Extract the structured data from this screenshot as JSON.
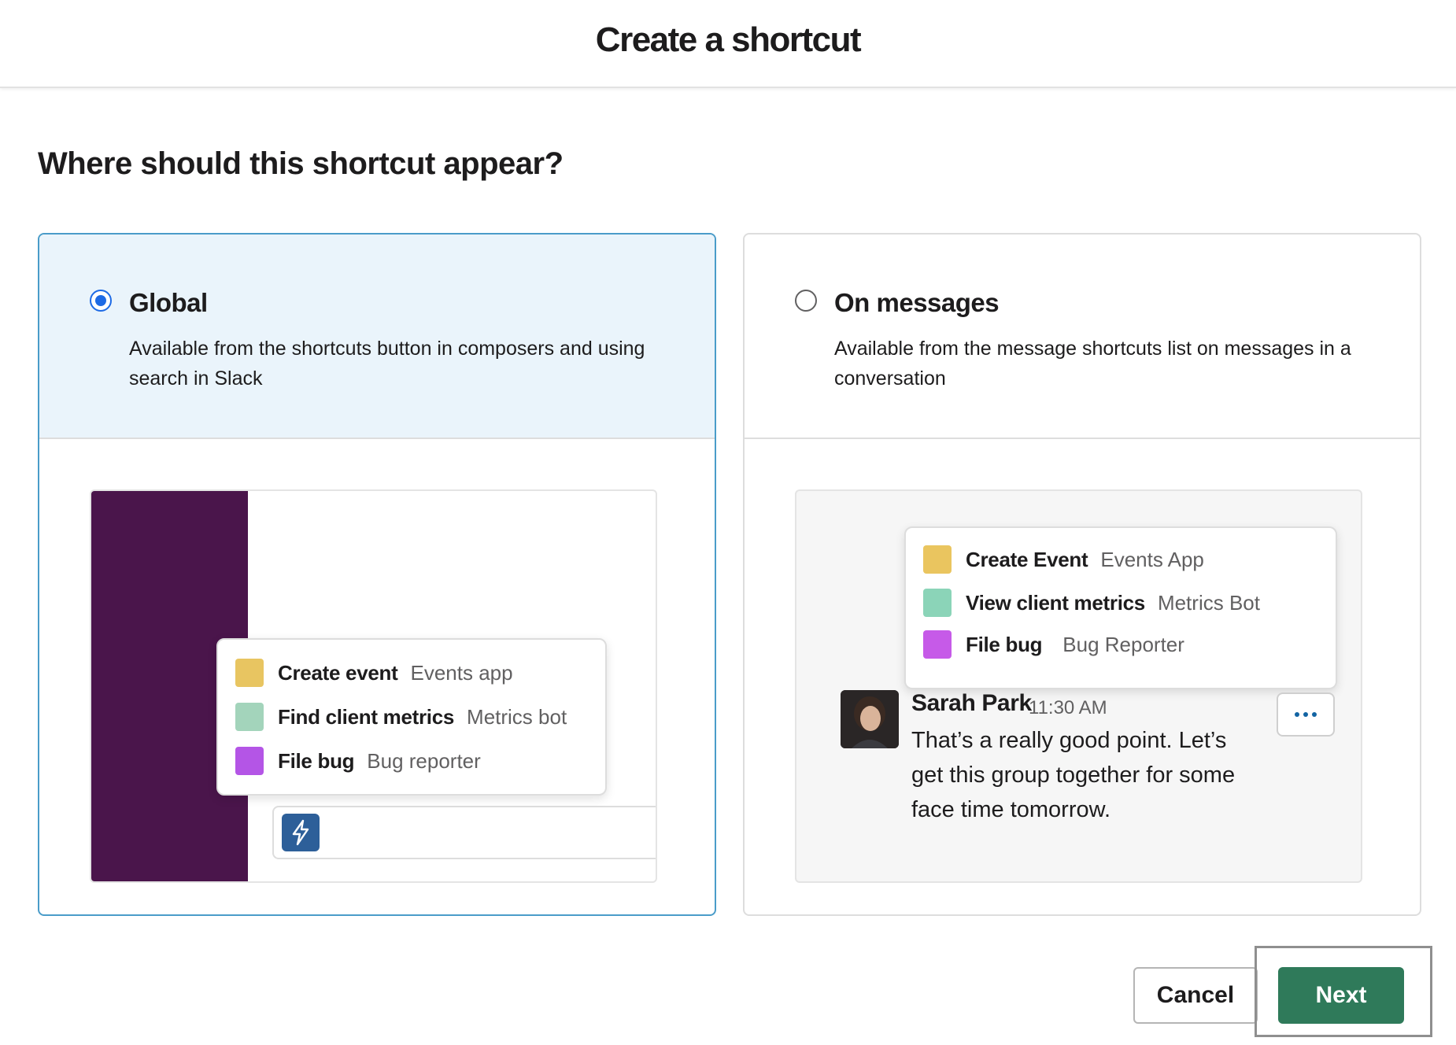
{
  "header": {
    "title": "Create a shortcut"
  },
  "question": "Where should this shortcut appear?",
  "options": [
    {
      "title": "Global",
      "description": "Available from the shortcuts button in composers and using search in Slack",
      "selected": true,
      "preview": {
        "menu": [
          {
            "name": "Create event",
            "app": "Events app",
            "color": "#e8c561"
          },
          {
            "name": "Find client metrics",
            "app": "Metrics bot",
            "color": "#a3d4bb"
          },
          {
            "name": "File bug",
            "app": "Bug reporter",
            "color": "#b455e6"
          }
        ],
        "sidebar_color": "#4a154b",
        "shortcut_button_icon": "lightning-bolt-icon"
      }
    },
    {
      "title": "On messages",
      "description": "Available from the message shortcuts list on messages in a conversation",
      "selected": false,
      "preview": {
        "menu": [
          {
            "name": "Create Event",
            "app": "Events App",
            "color": "#eac55f"
          },
          {
            "name": "View client metrics",
            "app": "Metrics Bot",
            "color": "#8bd4b8"
          },
          {
            "name": "File bug",
            "app": "Bug Reporter",
            "color": "#c65ae8"
          }
        ],
        "message": {
          "author": "Sarah Park",
          "time": "11:30 AM",
          "text": "That’s a really good point. Let’s get this group together for some face time tomorrow."
        },
        "more_actions_icon": "more-horizontal-icon"
      }
    }
  ],
  "buttons": {
    "cancel": "Cancel",
    "next": "Next"
  },
  "colors": {
    "accent": "#1d6ae5",
    "next_button": "#2f7a5a",
    "selected_card_bg": "#eaf4fb",
    "selected_card_border": "#4a9cc9"
  }
}
